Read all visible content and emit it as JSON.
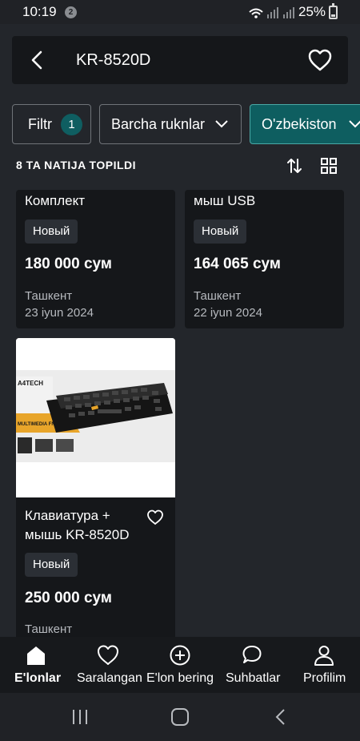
{
  "status": {
    "time": "10:19",
    "notif_count": "2",
    "battery": "25%",
    "battery_level": 0.25
  },
  "header": {
    "title": "KR-8520D",
    "back_icon": "back-arrow-icon",
    "fav_icon": "heart-outline-icon"
  },
  "filters": {
    "filtr_label": "Filtr",
    "filtr_count": "1",
    "category_label": "Barcha ruknlar",
    "region_label": "O'zbekiston"
  },
  "results": {
    "count_text": "8 TA NATIJA TOPILDI"
  },
  "listings": [
    {
      "title": "Комплект",
      "condition": "Новый",
      "price": "180 000 сум",
      "location": "Ташкент",
      "date": "23 iyun 2024"
    },
    {
      "title": "мыш USB",
      "condition": "Новый",
      "price": "164 065 сум",
      "location": "Ташкент",
      "date": "22 iyun 2024"
    },
    {
      "title_line1": "Клавиатура +",
      "title_line2": "мышь KR-8520D",
      "condition": "Новый",
      "price": "250 000 сум",
      "location": "Ташкент",
      "image": {
        "brand": "A4TECH",
        "banner": "MULTIMEDIA FN DESKTOP"
      }
    }
  ],
  "bottom_nav": [
    {
      "label": "E'lonlar",
      "icon": "home-icon",
      "active": true
    },
    {
      "label": "Saralangan",
      "icon": "heart-icon",
      "active": false
    },
    {
      "label": "E'lon bering",
      "icon": "plus-circle-icon",
      "active": false
    },
    {
      "label": "Suhbatlar",
      "icon": "chat-icon",
      "active": false
    },
    {
      "label": "Profilim",
      "icon": "user-icon",
      "active": false
    }
  ],
  "colors": {
    "accent": "#0e5e60",
    "background": "#23262b",
    "card": "#15171a"
  }
}
